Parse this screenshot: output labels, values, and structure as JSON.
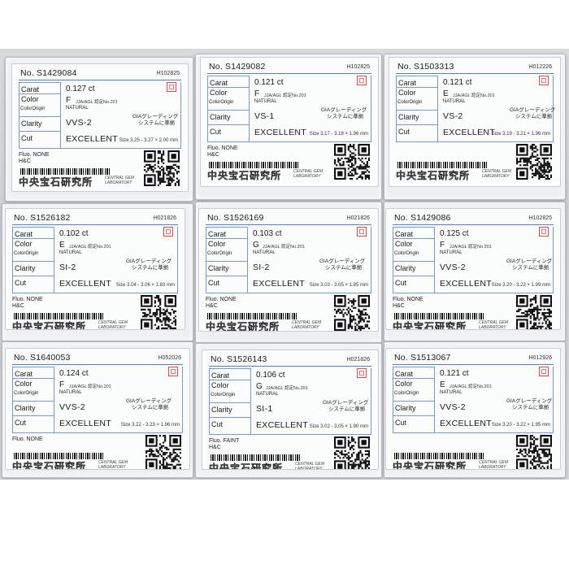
{
  "lab_name_en": [
    "CENTRAL GEM",
    "LABORATORY"
  ],
  "lab_logo_text": "中央宝石研究所",
  "jja_note": "JJA/AGL 認定No.201",
  "gia_note": [
    "GIAグレーディング",
    "システムに準拠"
  ],
  "labels": {
    "carat": "Carat",
    "color": "Color",
    "color_origin": "ColorOrigin",
    "clarity": "Clarity",
    "cut": "Cut"
  },
  "cards": [
    {
      "no": "No. S1429084",
      "h": "H102825",
      "carat": "0.127 ct",
      "color": "F",
      "origin": "NATURAL",
      "clarity": "VVS-2",
      "cut": "EXCELLENT",
      "size": "Size 3.25 - 3.27 × 2.00 mm",
      "fluo": "Fluo. NONE",
      "extra": "H&C"
    },
    {
      "no": "No. S1429082",
      "h": "H102825",
      "carat": "0.121 ct",
      "color": "F",
      "origin": "NATURAL",
      "clarity": "VS-1",
      "cut": "EXCELLENT",
      "size": "Size 3.17 - 3.18 × 1.96 mm",
      "fluo": "Fluo. NONE",
      "extra": "H&C"
    },
    {
      "no": "No. S1503313",
      "h": "H012226",
      "carat": "0.121 ct",
      "color": "E",
      "origin": "NATURAL",
      "clarity": "VS-2",
      "cut": "EXCELLENT",
      "size": "Size 3.19 - 3.21 × 1.96 mm",
      "fluo": "",
      "extra": ""
    },
    {
      "no": "No. S1526182",
      "h": "H021826",
      "carat": "0.102 ct",
      "color": "E",
      "origin": "NATURAL",
      "clarity": "SI-2",
      "cut": "EXCELLENT",
      "size": "Size 3.04 - 3.06 × 1.83 mm",
      "fluo": "Fluo. NONE",
      "extra": "H&C"
    },
    {
      "no": "No. S1526169",
      "h": "H021826",
      "carat": "0.103 ct",
      "color": "G",
      "origin": "NATURAL",
      "clarity": "SI-2",
      "cut": "EXCELLENT",
      "size": "Size 3.03 - 3.05 × 1.85 mm",
      "fluo": "Fluo. NONE",
      "extra": "H&C"
    },
    {
      "no": "No. S1429086",
      "h": "H102825",
      "carat": "0.125 ct",
      "color": "F",
      "origin": "NATURAL",
      "clarity": "VVS-2",
      "cut": "EXCELLENT",
      "size": "Size 3.20 - 3.22 × 1.99 mm",
      "fluo": "Fluo. NONE",
      "extra": "H&C"
    },
    {
      "no": "No. S1640053",
      "h": "H052026",
      "carat": "0.124 ct",
      "color": "F",
      "origin": "NATURAL",
      "clarity": "VVS-2",
      "cut": "EXCELLENT",
      "size": "Size 3.22 - 3.23 × 1.96 mm",
      "fluo": "Fluo. NONE",
      "extra": ""
    },
    {
      "no": "No. S1526143",
      "h": "H021826",
      "carat": "0.106 ct",
      "color": "G",
      "origin": "NATURAL",
      "clarity": "SI-1",
      "cut": "EXCELLENT",
      "size": "Size 3.02 - 3.05 × 1.90 mm",
      "fluo": "Fluo. FAINT",
      "extra": "H&C"
    },
    {
      "no": "No. S1513067",
      "h": "H012926",
      "carat": "0.121 ct",
      "color": "E",
      "origin": "NATURAL",
      "clarity": "VVS-2",
      "cut": "EXCELLENT",
      "size": "Size 3.20 - 3.22 × 1.95 mm",
      "fluo": "",
      "extra": ""
    }
  ]
}
